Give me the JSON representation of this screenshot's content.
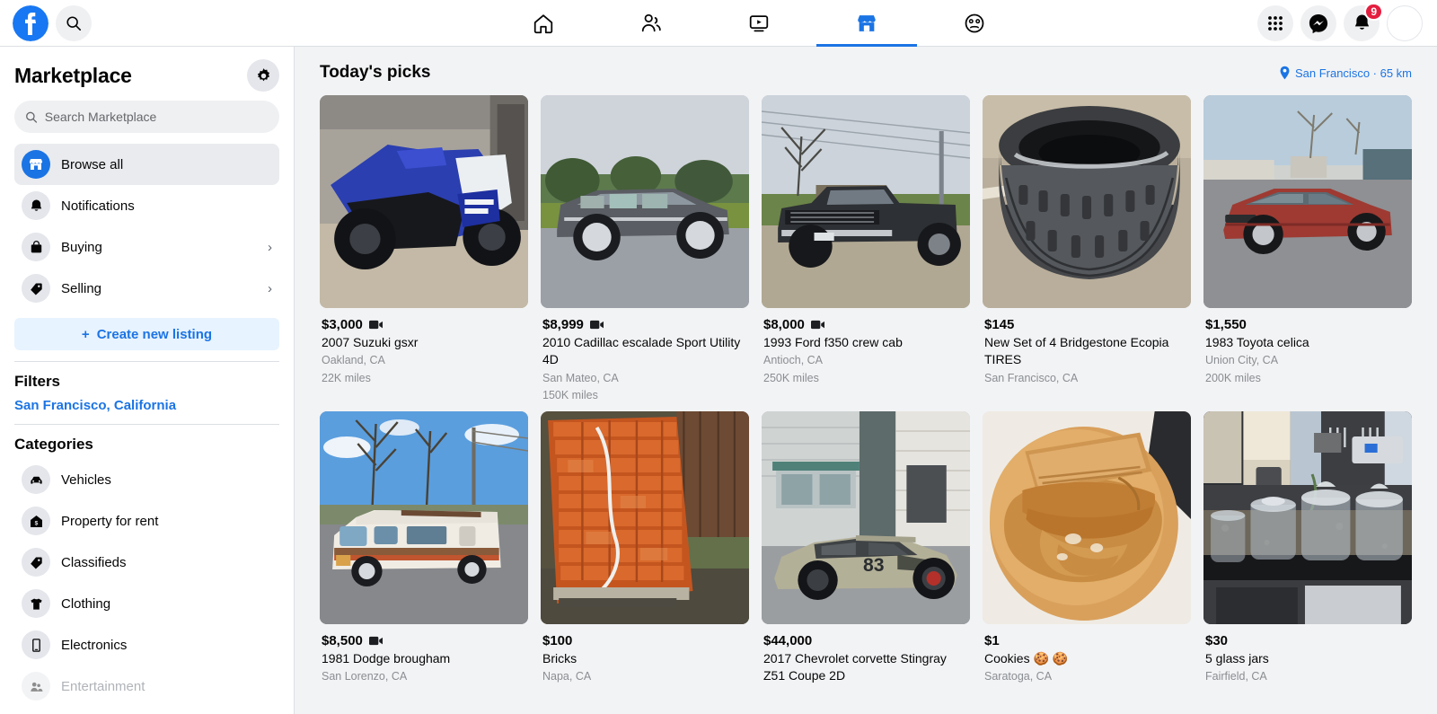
{
  "topbar": {
    "logo_name": "facebook-logo",
    "search_icon": "search-icon",
    "nav_tabs": [
      {
        "name": "home",
        "icon": "home-icon",
        "active": false
      },
      {
        "name": "friends",
        "icon": "friends-icon",
        "active": false
      },
      {
        "name": "watch",
        "icon": "video-icon",
        "active": false
      },
      {
        "name": "marketplace",
        "icon": "marketplace-icon",
        "active": true
      },
      {
        "name": "gaming",
        "icon": "gaming-icon",
        "active": false
      }
    ],
    "menu_icon": "grid-menu-icon",
    "messenger_icon": "messenger-icon",
    "notifications_icon": "bell-icon",
    "notifications_count": "9",
    "avatar_name": "profile-avatar"
  },
  "sidebar": {
    "title": "Marketplace",
    "settings_icon": "gear-icon",
    "search": {
      "placeholder": "Search Marketplace",
      "value": "",
      "icon": "search-icon"
    },
    "nav": [
      {
        "label": "Browse all",
        "icon": "store-icon",
        "selected": true,
        "chevron": false
      },
      {
        "label": "Notifications",
        "icon": "bell-icon",
        "selected": false,
        "chevron": false
      },
      {
        "label": "Buying",
        "icon": "bag-icon",
        "selected": false,
        "chevron": true
      },
      {
        "label": "Selling",
        "icon": "tag-icon",
        "selected": false,
        "chevron": true
      }
    ],
    "create_listing": "Create new listing",
    "create_listing_icon": "plus-icon",
    "filters_title": "Filters",
    "filter_location": "San Francisco, California",
    "categories_title": "Categories",
    "categories": [
      {
        "label": "Vehicles",
        "icon": "car-icon",
        "dim": false
      },
      {
        "label": "Property for rent",
        "icon": "house-rent-icon",
        "dim": false
      },
      {
        "label": "Classifieds",
        "icon": "tag-icon",
        "dim": false
      },
      {
        "label": "Clothing",
        "icon": "shirt-icon",
        "dim": false
      },
      {
        "label": "Electronics",
        "icon": "phone-icon",
        "dim": false
      },
      {
        "label": "Entertainment",
        "icon": "entertainment-icon",
        "dim": true
      }
    ]
  },
  "main": {
    "heading": "Today's picks",
    "location_icon": "map-pin-icon",
    "location": "San Francisco · 65 km",
    "video_icon": "video-camera-icon",
    "listings": [
      {
        "price": "$3,000",
        "has_video": true,
        "title": "2007 Suzuki gsxr",
        "location": "Oakland, CA",
        "mileage": "22K miles",
        "image": "motorcycle"
      },
      {
        "price": "$8,999",
        "has_video": true,
        "title": "2010 Cadillac escalade Sport Utility 4D",
        "location": "San Mateo, CA",
        "mileage": "150K miles",
        "image": "suv"
      },
      {
        "price": "$8,000",
        "has_video": true,
        "title": "1993 Ford f350 crew cab",
        "location": "Antioch, CA",
        "mileage": "250K miles",
        "image": "truck"
      },
      {
        "price": "$145",
        "has_video": false,
        "title": "New Set of 4 Bridgestone Ecopia TIRES",
        "location": "San Francisco, CA",
        "mileage": "",
        "image": "tires"
      },
      {
        "price": "$1,550",
        "has_video": false,
        "title": "1983 Toyota celica",
        "location": "Union City, CA",
        "mileage": "200K miles",
        "image": "celica"
      },
      {
        "price": "$8,500",
        "has_video": true,
        "title": "1981 Dodge brougham",
        "location": "San Lorenzo, CA",
        "mileage": "",
        "image": "rv"
      },
      {
        "price": "$100",
        "has_video": false,
        "title": "Bricks",
        "location": "Napa, CA",
        "mileage": "",
        "image": "bricks"
      },
      {
        "price": "$44,000",
        "has_video": false,
        "title": "2017 Chevrolet corvette Stingray Z51 Coupe 2D",
        "location": "",
        "mileage": "",
        "image": "corvette"
      },
      {
        "price": "$1",
        "has_video": false,
        "title": "Cookies 🍪 🍪",
        "location": "Saratoga, CA",
        "mileage": "",
        "image": "cookies"
      },
      {
        "price": "$30",
        "has_video": false,
        "title": "5 glass jars",
        "location": "Fairfield, CA",
        "mileage": "",
        "image": "jars"
      }
    ]
  },
  "colors": {
    "fb_blue": "#1b74e4",
    "badge_red": "#e41e3f",
    "page_bg": "#f2f3f5",
    "muted_text": "#8a8d91"
  }
}
